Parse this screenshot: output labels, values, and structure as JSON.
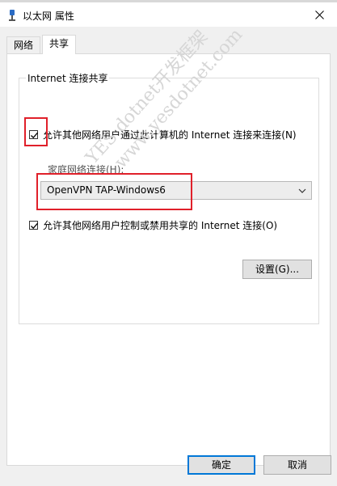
{
  "window": {
    "title": "以太网 属性"
  },
  "tabs": [
    {
      "label": "网络"
    },
    {
      "label": "共享"
    }
  ],
  "sharing": {
    "group_title": "Internet 连接共享",
    "allow_connect_label": "允许其他网络用户通过此计算机的 Internet 连接来连接(N)",
    "allow_connect_checked": true,
    "home_network_label": "家庭网络连接(H):",
    "home_network_value": "OpenVPN TAP-Windows6",
    "allow_control_label": "允许其他网络用户控制或禁用共享的 Internet 连接(O)",
    "allow_control_checked": true,
    "settings_button": "设置(G)..."
  },
  "footer": {
    "ok_button": "确定",
    "cancel_button": "取消"
  },
  "watermark": {
    "line1": "YES dotnet开发框架",
    "line2": "www.yesdotnet.com"
  },
  "colors": {
    "highlight_box": "#e0202a",
    "primary_border": "#0078d7"
  }
}
